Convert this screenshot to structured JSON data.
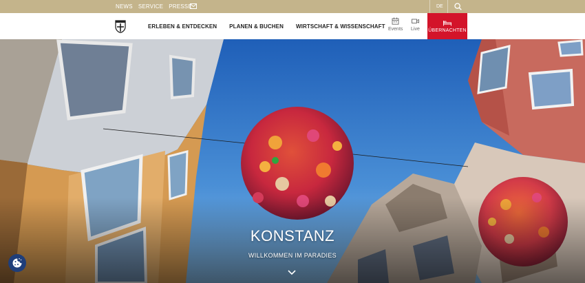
{
  "topbar": {
    "links": [
      "NEWS",
      "SERVICE",
      "PRESSE"
    ],
    "mail_icon": "mail-icon",
    "language": "DE",
    "search_icon": "search-icon"
  },
  "nav": {
    "logo_icon": "konstanz-crest-icon",
    "items": [
      "ERLEBEN & ENTDECKEN",
      "PLANEN & BUCHEN",
      "WIRTSCHAFT & WISSENSCHAFT"
    ],
    "events_label": "Events",
    "live_label": "Live",
    "book_label": "ÜBERNACHTEN",
    "accent_color": "#d3142a",
    "topbar_color": "#c4b48b"
  },
  "hero": {
    "title": "KONSTANZ",
    "subtitle": "WILLKOMMEN IM PARADIES",
    "scroll_icon": "chevron-down-icon"
  },
  "cookie": {
    "icon": "cookie-icon"
  }
}
